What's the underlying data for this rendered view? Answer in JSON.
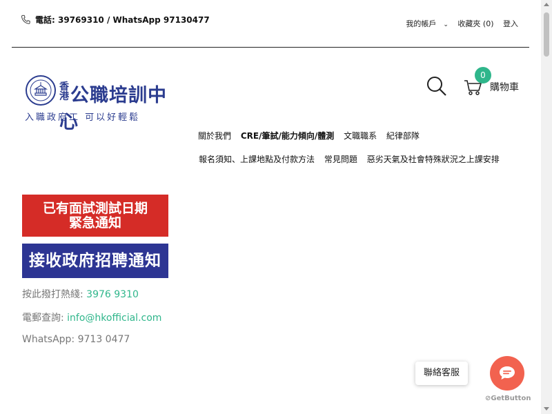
{
  "topbar": {
    "phone_text": "電話: 39769310 / WhatsApp 97130477",
    "account_label": "我的帳戶",
    "favorites_label": "收藏夾 (0)",
    "login_label": "登入"
  },
  "logo": {
    "title_small": "香港",
    "title_main": "公職培訓中心",
    "slogan": "入職政府工 可以好輕鬆"
  },
  "cart": {
    "count": "0",
    "label": "購物車"
  },
  "nav": {
    "row1": [
      "關於我們",
      "CRE/筆試/能力傾向/體測",
      "文職職系",
      "紀律部隊"
    ],
    "row2": [
      "報名須知、上課地點及付款方法",
      "常見問題",
      "惡劣天氣及社會特殊狀況之上課安排"
    ]
  },
  "banners": {
    "urgent_line1": "已有面試測試日期",
    "urgent_line2": "緊急通知",
    "recruit": "接收政府招聘通知"
  },
  "contact": {
    "hotline_label": "按此撥打熱綫: ",
    "hotline_value": "3976 9310",
    "email_label": "電郵查詢: ",
    "email_value": "info@hkofficial.com",
    "whatsapp": "WhatsApp: 9713 0477"
  },
  "chat": {
    "bubble_label": "聯絡客服",
    "brand": "GetButton"
  },
  "colors": {
    "accent_green": "#2fb68b",
    "banner_red": "#d52c27",
    "banner_blue": "#2d3593",
    "chat_orange": "#f2624f",
    "logo_blue": "#2b3c8f"
  }
}
